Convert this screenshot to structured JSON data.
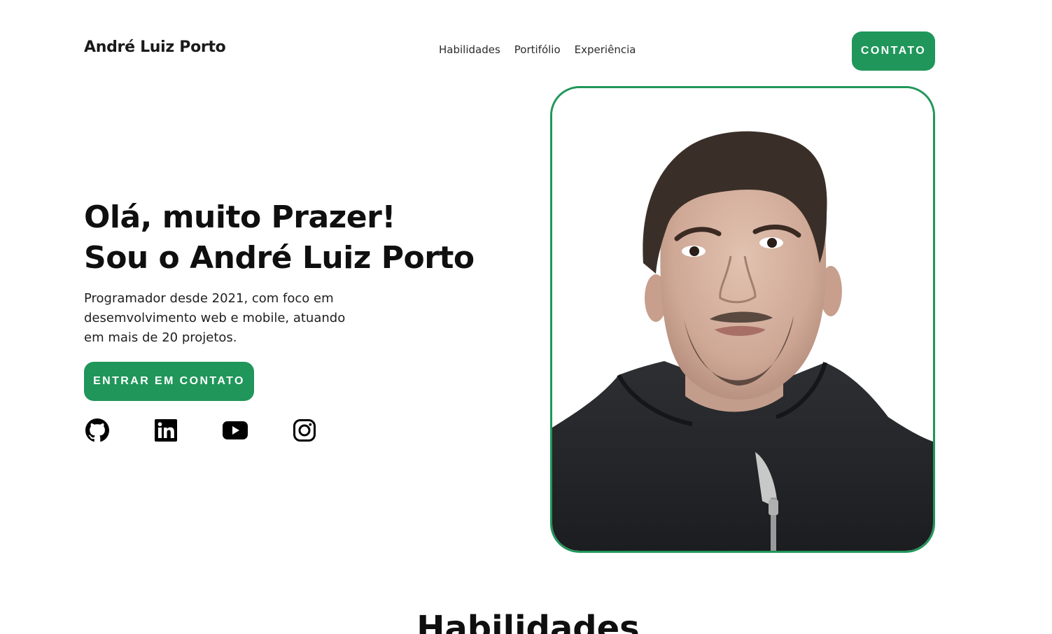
{
  "header": {
    "logo": "André Luiz Porto",
    "nav": [
      {
        "label": "Habilidades"
      },
      {
        "label": "Portifólio"
      },
      {
        "label": "Experiência"
      }
    ],
    "contact_button": "CONTATO"
  },
  "hero": {
    "title_line1": "Olá, muito Prazer!",
    "title_line2": "Sou o André Luiz Porto",
    "description": "Programador desde 2021, com foco em desemvolvimento web e mobile, atuando em mais de 20 projetos.",
    "cta": "ENTRAR EM CONTATO",
    "socials": [
      {
        "icon": "github-icon"
      },
      {
        "icon": "linkedin-icon"
      },
      {
        "icon": "youtube-icon"
      },
      {
        "icon": "instagram-icon"
      }
    ]
  },
  "skills": {
    "title": "Habilidades"
  },
  "colors": {
    "accent": "#20965a",
    "text": "#111111",
    "background": "#ffffff"
  }
}
